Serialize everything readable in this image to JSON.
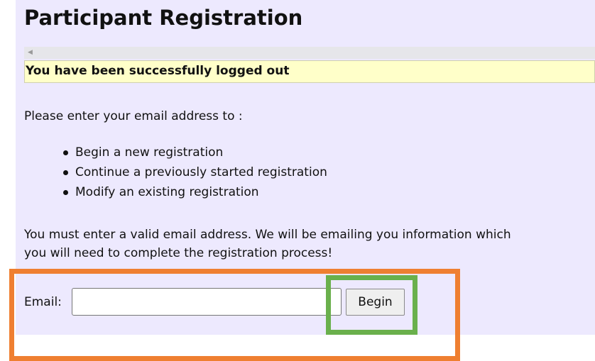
{
  "page": {
    "title": "Participant Registration"
  },
  "notice": {
    "text": "You have been successfully logged out"
  },
  "scrollbar": {
    "left_arrow_icon": "left-arrow-icon"
  },
  "intro": {
    "text": "Please enter your email address to :"
  },
  "options": [
    {
      "label": "Begin a new registration"
    },
    {
      "label": "Continue a previously started registration"
    },
    {
      "label": "Modify an existing registration"
    }
  ],
  "instructions": {
    "line1": "You must enter a valid email address. We will be emailing you information which",
    "line2": "you will need to complete the registration process!"
  },
  "form": {
    "email_label": "Email:",
    "email_value": "",
    "begin_label": "Begin"
  },
  "colors": {
    "panel_bg": "#ede9fe",
    "notice_bg": "#ffffc9",
    "highlight_orange": "#ef7f31",
    "highlight_green": "#6ab04c"
  }
}
